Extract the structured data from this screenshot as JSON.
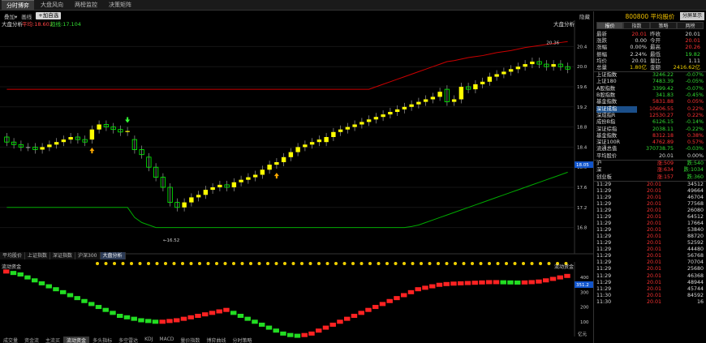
{
  "top_tabs": [
    "分时博弈",
    "大盘风向",
    "两榜监控",
    "决策矩阵"
  ],
  "toolbar": {
    "items": [
      "叠加▾",
      "画线"
    ],
    "add_button": "+加自选",
    "hide": "隐藏",
    "chart_title": "大盘分析"
  },
  "legend": {
    "title": "大盘分析",
    "short": "平均:18.603",
    "long": "趋线:17.104"
  },
  "bottom_tabs": [
    "平均股价",
    "上证指数",
    "深证指数",
    "沪深300",
    "大盘分析"
  ],
  "footer_tabs": [
    "成交量",
    "资金流",
    "主流买",
    "流动资金",
    "多头指标",
    "多空雷达",
    "KDJ",
    "MACD",
    "量价指数",
    "博弈曲线",
    "分时策略"
  ],
  "lower_title": "流动资金",
  "lower_right_title": "流动资金",
  "lower_current": "351.2",
  "lower_axis_unit": "亿元",
  "colors": {
    "up": "#ffff00",
    "down": "#00ff00",
    "upper_band": "#cc0000",
    "lower_band": "#00aa00",
    "label_bg": "#1155cc"
  },
  "icons": [
    "arrow-up-icon",
    "arrow-down-icon"
  ],
  "chart_data": {
    "type": "candlestick",
    "y_ticks": [
      "20.4",
      "20.0",
      "19.6",
      "19.2",
      "18.8",
      "18.4",
      "18.0",
      "17.6",
      "17.2",
      "16.8"
    ],
    "ylim": [
      16.6,
      20.6
    ],
    "current_label": "18.05",
    "max_label": "20.36",
    "min_label": "16.52",
    "candles": [
      [
        18.6,
        18.5
      ],
      [
        18.5,
        18.45
      ],
      [
        18.45,
        18.4
      ],
      [
        18.4,
        18.4
      ],
      [
        18.4,
        18.35
      ],
      [
        18.35,
        18.4
      ],
      [
        18.4,
        18.45
      ],
      [
        18.45,
        18.5
      ],
      [
        18.5,
        18.55
      ],
      [
        18.55,
        18.6
      ],
      [
        18.6,
        18.55
      ],
      [
        18.55,
        18.5
      ],
      [
        18.55,
        18.75
      ],
      [
        18.75,
        18.85
      ],
      [
        18.85,
        18.8
      ],
      [
        18.8,
        18.75
      ],
      [
        18.75,
        18.7
      ],
      [
        18.7,
        18.72
      ],
      [
        18.55,
        18.35
      ],
      [
        18.35,
        18.25
      ],
      [
        18.2,
        18.0
      ],
      [
        18.0,
        17.8
      ],
      [
        17.8,
        17.6
      ],
      [
        17.6,
        17.3
      ],
      [
        17.3,
        17.2
      ],
      [
        17.2,
        17.3
      ],
      [
        17.3,
        17.4
      ],
      [
        17.4,
        17.45
      ],
      [
        17.45,
        17.55
      ],
      [
        17.55,
        17.6
      ],
      [
        17.6,
        17.65
      ],
      [
        17.65,
        17.6
      ],
      [
        17.6,
        17.7
      ],
      [
        17.7,
        17.75
      ],
      [
        17.75,
        17.8
      ],
      [
        17.8,
        17.85
      ],
      [
        17.85,
        17.95
      ],
      [
        17.95,
        18.05
      ],
      [
        18.05,
        18.1
      ],
      [
        18.1,
        18.2
      ],
      [
        18.2,
        18.3
      ],
      [
        18.3,
        18.4
      ],
      [
        18.4,
        18.45
      ],
      [
        18.45,
        18.5
      ],
      [
        18.5,
        18.55
      ],
      [
        18.5,
        18.6
      ],
      [
        18.6,
        18.7
      ],
      [
        18.7,
        18.75
      ],
      [
        18.75,
        18.8
      ],
      [
        18.8,
        18.85
      ],
      [
        18.85,
        18.9
      ],
      [
        18.9,
        18.95
      ],
      [
        18.95,
        19.0
      ],
      [
        19.0,
        19.05
      ],
      [
        19.05,
        19.1
      ],
      [
        19.1,
        19.15
      ],
      [
        19.15,
        19.2
      ],
      [
        19.2,
        19.25
      ],
      [
        19.25,
        19.3
      ],
      [
        19.3,
        19.35
      ],
      [
        19.35,
        19.4
      ],
      [
        19.4,
        19.5
      ],
      [
        19.55,
        19.3
      ],
      [
        19.3,
        19.35
      ],
      [
        19.35,
        19.6
      ],
      [
        19.6,
        19.55
      ],
      [
        19.55,
        19.65
      ],
      [
        19.65,
        19.7
      ],
      [
        19.7,
        19.8
      ],
      [
        19.8,
        19.85
      ],
      [
        19.85,
        19.9
      ],
      [
        19.9,
        19.95
      ],
      [
        19.95,
        20.0
      ],
      [
        20.0,
        20.05
      ],
      [
        20.05,
        20.1
      ],
      [
        20.1,
        20.05
      ],
      [
        20.05,
        20.0
      ],
      [
        20.0,
        20.05
      ],
      [
        20.05,
        20.0
      ],
      [
        20.0,
        19.95
      ]
    ],
    "upper_band": [
      19.55,
      19.55,
      19.55,
      19.55,
      19.55,
      19.55,
      19.55,
      19.55,
      19.55,
      19.55,
      19.55,
      19.55,
      19.55,
      19.55,
      19.55,
      19.55,
      19.55,
      19.55,
      19.55,
      19.55,
      19.55,
      19.55,
      19.55,
      19.55,
      19.55,
      19.55,
      19.55,
      19.55,
      19.55,
      19.55,
      19.55,
      19.55,
      19.55,
      19.55,
      19.55,
      19.55,
      19.55,
      19.55,
      19.55,
      19.55,
      19.55,
      19.55,
      19.55,
      19.55,
      19.55,
      19.55,
      19.55,
      19.55,
      19.55,
      19.55,
      19.55,
      19.55,
      19.6,
      19.65,
      19.7,
      19.75,
      19.8,
      19.85,
      19.9,
      19.95,
      20.0,
      20.05,
      20.1,
      20.12,
      20.15,
      20.18,
      20.2,
      20.22,
      20.25,
      20.28,
      20.3,
      20.32,
      20.35,
      20.38,
      20.4,
      20.42,
      20.44,
      20.46,
      20.48,
      20.5
    ],
    "lower_band": [
      17.2,
      17.2,
      17.2,
      17.2,
      17.2,
      17.2,
      17.2,
      17.2,
      17.2,
      17.2,
      17.2,
      17.2,
      17.2,
      17.2,
      17.2,
      17.2,
      17.2,
      17.2,
      17.0,
      16.9,
      16.85,
      16.8,
      16.8,
      16.8,
      16.8,
      16.8,
      16.8,
      16.8,
      16.8,
      16.8,
      16.8,
      16.8,
      16.8,
      16.8,
      16.8,
      16.8,
      16.8,
      16.8,
      16.8,
      16.8,
      16.8,
      16.8,
      16.8,
      16.8,
      16.8,
      16.8,
      16.8,
      16.8,
      16.8,
      16.8,
      16.8,
      16.8,
      16.8,
      16.8,
      16.8,
      16.8,
      16.8,
      16.82,
      16.85,
      16.9,
      16.95,
      17.0,
      17.05,
      17.1,
      17.15,
      17.2,
      17.25,
      17.3,
      17.35,
      17.4,
      17.45,
      17.5,
      17.55,
      17.6,
      17.65,
      17.7,
      17.75,
      17.8,
      17.85,
      17.9
    ],
    "signals": [
      {
        "index": 12,
        "dir": "up"
      },
      {
        "index": 17,
        "dir": "down"
      },
      {
        "index": 38,
        "dir": "up"
      }
    ],
    "lower_ticks": [
      "400",
      "300",
      "200",
      "100"
    ],
    "lower_ylim": [
      0,
      450
    ],
    "flow": [
      440,
      430,
      420,
      400,
      380,
      360,
      340,
      320,
      300,
      280,
      260,
      240,
      220,
      200,
      180,
      160,
      140,
      130,
      120,
      110,
      105,
      100,
      100,
      105,
      110,
      120,
      130,
      140,
      150,
      160,
      170,
      180,
      160,
      140,
      120,
      100,
      80,
      60,
      40,
      20,
      10,
      5,
      10,
      20,
      40,
      60,
      80,
      100,
      120,
      140,
      160,
      180,
      200,
      220,
      240,
      260,
      280,
      300,
      320,
      330,
      340,
      350,
      355,
      358,
      360,
      362,
      364,
      366,
      368,
      368,
      367,
      366,
      365,
      366,
      368,
      372,
      380,
      390,
      400,
      410
    ]
  },
  "quote": {
    "title": "800800 平均股价",
    "button": "分屏显示",
    "tabs": [
      "报价",
      "指数",
      "策略",
      "两榜"
    ],
    "rows": [
      [
        [
          "最新",
          "20.01",
          "red"
        ],
        [
          "昨收",
          "20.01",
          "white"
        ]
      ],
      [
        [
          "涨跌",
          "0.00",
          "white"
        ],
        [
          "今开",
          "20.01",
          "red"
        ]
      ],
      [
        [
          "涨幅",
          "0.00%",
          "white"
        ],
        [
          "最高",
          "20.26",
          "red"
        ]
      ],
      [
        [
          "振幅",
          "2.24%",
          "white"
        ],
        [
          "最低",
          "19.82",
          "green"
        ]
      ],
      [
        [
          "均价",
          "20.01",
          "white"
        ],
        [
          "量比",
          "1.11",
          "white"
        ]
      ],
      [
        [
          "总量",
          "1.80亿",
          "yellow"
        ],
        [
          "金额",
          "2416.62亿",
          "yellow"
        ]
      ]
    ],
    "indices": [
      [
        "上证指数",
        "3246.22",
        "-0.07%",
        "green"
      ],
      [
        "上证180",
        "7483.39",
        "-0.05%",
        "green"
      ],
      [
        "A股指数",
        "3399.42",
        "-0.07%",
        "green"
      ],
      [
        "B股指数",
        "341.83",
        "-0.45%",
        "green"
      ],
      [
        "基金指数",
        "5831.88",
        "0.05%",
        "red"
      ],
      [
        "深证成指",
        "10606.55",
        "0.22%",
        "red"
      ],
      [
        "深成指R",
        "12530.27",
        "0.22%",
        "red"
      ],
      [
        "成份B指",
        "6126.15",
        "-0.14%",
        "green"
      ],
      [
        "深证综指",
        "2038.11",
        "-0.22%",
        "green"
      ],
      [
        "基金指数",
        "8312.18",
        "0.38%",
        "red"
      ],
      [
        "深证100R",
        "4762.89",
        "0.57%",
        "red"
      ],
      [
        "流通总值",
        "370738.75",
        "-0.03%",
        "green"
      ],
      [
        "平均股价",
        "20.01",
        "0.00%",
        "white"
      ]
    ],
    "breadth": [
      [
        "沪",
        "涨:509",
        "跌:540"
      ],
      [
        "深",
        "涨:634",
        "跌:1034"
      ],
      [
        "创业板",
        "涨:157",
        "跌:360"
      ]
    ],
    "ticks": [
      [
        "11:29",
        "20.01",
        "34512"
      ],
      [
        "11:29",
        "20.01",
        "49664"
      ],
      [
        "11:29",
        "20.01",
        "46704"
      ],
      [
        "11:29",
        "20.01",
        "77568"
      ],
      [
        "11:29",
        "20.01",
        "26080"
      ],
      [
        "11:29",
        "20.01",
        "64512"
      ],
      [
        "11:29",
        "20.01",
        "17664"
      ],
      [
        "11:29",
        "20.01",
        "53840"
      ],
      [
        "11:29",
        "20.01",
        "88720"
      ],
      [
        "11:29",
        "20.01",
        "52592"
      ],
      [
        "11:29",
        "20.01",
        "44480"
      ],
      [
        "11:29",
        "20.01",
        "56768"
      ],
      [
        "11:29",
        "20.01",
        "70704"
      ],
      [
        "11:29",
        "20.01",
        "25680"
      ],
      [
        "11:29",
        "20.01",
        "46368"
      ],
      [
        "11:29",
        "20.01",
        "48944"
      ],
      [
        "11:29",
        "20.01",
        "45744"
      ],
      [
        "11:30",
        "20.01",
        "84592"
      ],
      [
        "11:30",
        "20.01",
        "16"
      ]
    ]
  }
}
